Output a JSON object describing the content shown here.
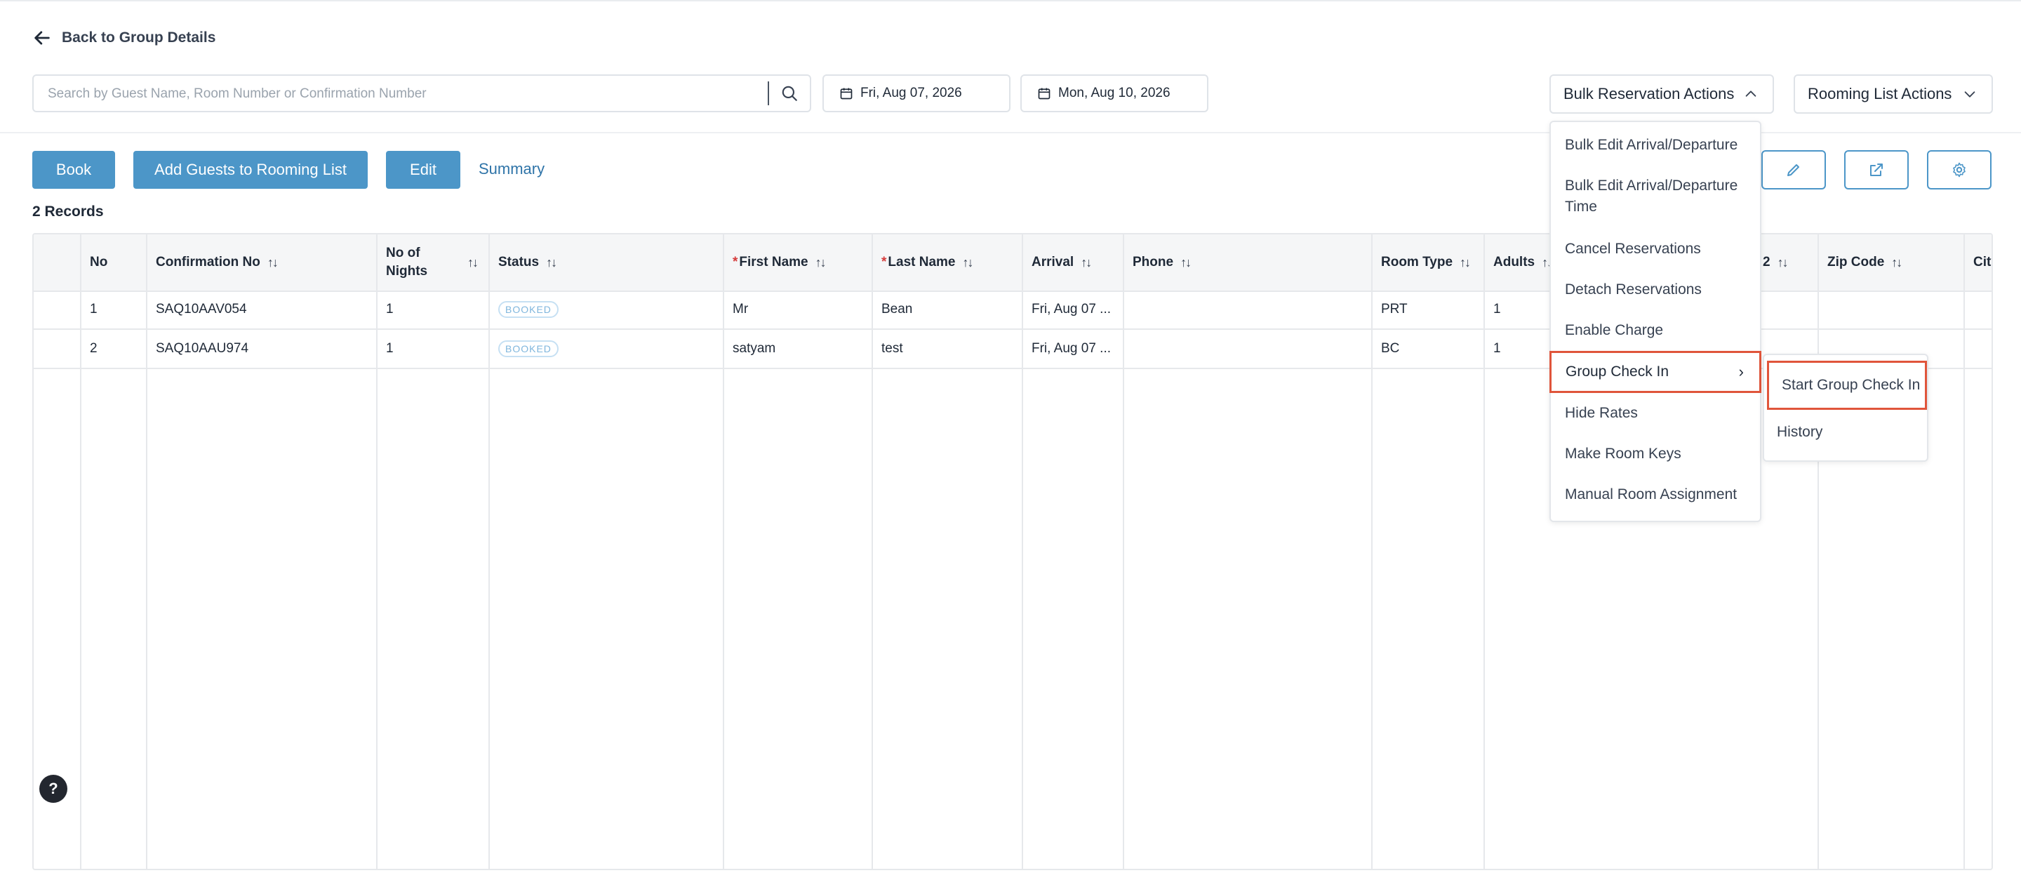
{
  "nav": {
    "back_label": "Back to Group Details"
  },
  "search": {
    "placeholder": "Search by Guest Name, Room Number or Confirmation Number",
    "value": ""
  },
  "dates": {
    "start": "Fri, Aug 07, 2026",
    "end": "Mon, Aug 10, 2026"
  },
  "dropdowns": {
    "bulk_label": "Bulk Reservation Actions",
    "rooming_label": "Rooming List Actions"
  },
  "toolbar": {
    "book": "Book",
    "add_guests": "Add Guests to Rooming List",
    "edit": "Edit",
    "summary": "Summary"
  },
  "records_label": "2 Records",
  "table": {
    "headers": {
      "no": "No",
      "conf": "Confirmation No",
      "nights_1": "No of",
      "nights_2": "Nights",
      "status": "Status",
      "first": "First Name",
      "last": "Last Name",
      "arrival": "Arrival",
      "phone": "Phone",
      "room_type": "Room Type",
      "adults": "Adults",
      "address2": "2",
      "zip": "Zip Code",
      "city": "City"
    },
    "rows": [
      {
        "no": "1",
        "conf": "SAQ10AAV054",
        "nights": "1",
        "status": "BOOKED",
        "first": "Mr",
        "last": "Bean",
        "arrival": "Fri, Aug 07 ...",
        "phone": "",
        "room_type": "PRT",
        "adults": "1"
      },
      {
        "no": "2",
        "conf": "SAQ10AAU974",
        "nights": "1",
        "status": "BOOKED",
        "first": "satyam",
        "last": "test",
        "arrival": "Fri, Aug 07 ...",
        "phone": "",
        "room_type": "BC",
        "adults": "1"
      }
    ]
  },
  "bulk_menu": {
    "items": [
      "Bulk Edit Arrival/Departure",
      "Bulk Edit Arrival/Departure Time",
      "Cancel Reservations",
      "Detach Reservations",
      "Enable Charge",
      "Group Check In",
      "Hide Rates",
      "Make Room Keys",
      "Manual Room Assignment"
    ],
    "submenu": [
      "Start Group Check In",
      "History"
    ]
  },
  "help_label": "?",
  "colors": {
    "accent": "#4c96c8",
    "highlight": "#e0553b",
    "required": "#d53b3b"
  }
}
